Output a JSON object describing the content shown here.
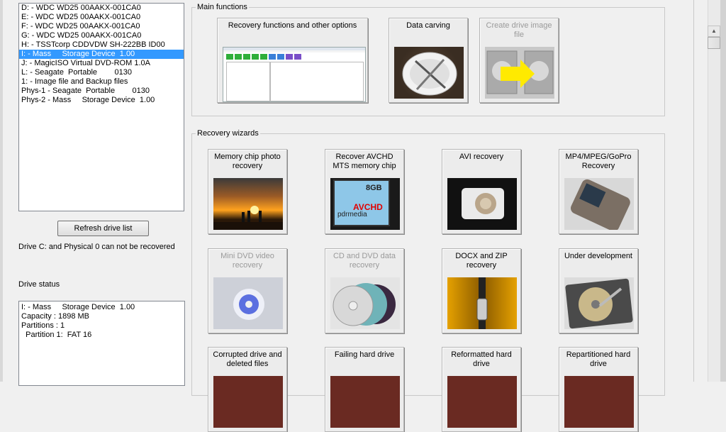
{
  "drive_list": [
    {
      "label": "D: - WDC WD25 00AAKX-001CA0"
    },
    {
      "label": "E: - WDC WD25 00AAKX-001CA0"
    },
    {
      "label": "F: - WDC WD25 00AAKX-001CA0"
    },
    {
      "label": "G: - WDC WD25 00AAKX-001CA0"
    },
    {
      "label": "H: - TSSTcorp CDDVDW SH-222BB ID00"
    },
    {
      "label": "I: - Mass     Storage Device  1.00",
      "selected": true
    },
    {
      "label": "J: - MagicISO Virtual DVD-ROM 1.0A"
    },
    {
      "label": "L: - Seagate  Portable        0130"
    },
    {
      "label": "1: - Image file and Backup files"
    },
    {
      "label": "Phys-1 - Seagate  Portable        0130"
    },
    {
      "label": "Phys-2 - Mass     Storage Device  1.00"
    }
  ],
  "refresh_label": "Refresh drive list",
  "drive_note": "Drive C: and Physical 0 can not be recovered",
  "status_label": "Drive status",
  "status_lines": [
    "I: - Mass     Storage Device  1.00",
    "Capacity : 1898 MB",
    "Partitions : 1",
    "  Partition 1:  FAT 16"
  ],
  "main_functions": {
    "title": "Main functions",
    "tiles": [
      {
        "label": "Recovery functions and other options"
      },
      {
        "label": "Data carving"
      },
      {
        "label": "Create drive image file",
        "disabled": true
      }
    ]
  },
  "wizards": {
    "title": "Recovery wizards",
    "tiles": [
      {
        "label": "Memory chip photo recovery"
      },
      {
        "label": "Recover AVCHD MTS memory chip",
        "sd_text": "8GB",
        "sd_brand": "pdrmedia",
        "overlay": "AVCHD"
      },
      {
        "label": "AVI recovery"
      },
      {
        "label": "MP4/MPEG/GoPro Recovery"
      },
      {
        "label": "Mini DVD video recovery",
        "disabled": true
      },
      {
        "label": "CD and DVD data recovery",
        "disabled": true
      },
      {
        "label": "DOCX and ZIP recovery"
      },
      {
        "label": "Under development"
      },
      {
        "label": "Corrupted drive and deleted files"
      },
      {
        "label": "Failing hard drive"
      },
      {
        "label": "Reformatted hard drive"
      },
      {
        "label": "Repartitioned hard drive"
      }
    ]
  }
}
